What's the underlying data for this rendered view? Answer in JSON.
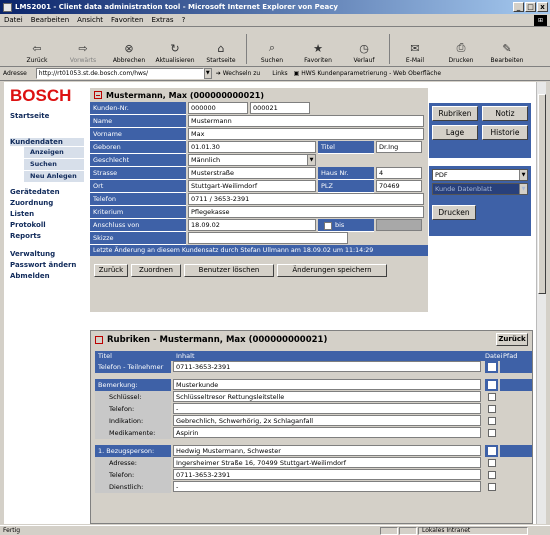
{
  "window": {
    "title": "LMS2001 - Client data administration tool - Microsoft Internet Explorer von Peacy",
    "btn_min": "_",
    "btn_max": "□",
    "btn_close": "x"
  },
  "menu": [
    "Datei",
    "Bearbeiten",
    "Ansicht",
    "Favoriten",
    "Extras",
    "?"
  ],
  "toolbar": [
    {
      "label": "Zurück",
      "icon": "back-arrow-icon",
      "glyph": "⇦"
    },
    {
      "label": "Vorwärts",
      "icon": "forward-arrow-icon",
      "glyph": "⇨"
    },
    {
      "label": "Abbrechen",
      "icon": "stop-icon",
      "glyph": "⊗"
    },
    {
      "label": "Aktualisieren",
      "icon": "refresh-icon",
      "glyph": "↻"
    },
    {
      "label": "Startseite",
      "icon": "home-icon",
      "glyph": "⌂"
    },
    {
      "label": "Suchen",
      "icon": "search-icon",
      "glyph": "⌕"
    },
    {
      "label": "Favoriten",
      "icon": "favorites-icon",
      "glyph": "★"
    },
    {
      "label": "Verlauf",
      "icon": "history-icon",
      "glyph": "◷"
    },
    {
      "label": "E-Mail",
      "icon": "mail-icon",
      "glyph": "✉"
    },
    {
      "label": "Drucken",
      "icon": "print-icon",
      "glyph": "⎙"
    },
    {
      "label": "Bearbeiten",
      "icon": "edit-icon",
      "glyph": "✎"
    }
  ],
  "address": {
    "label": "Adresse",
    "url": "http://rt01053.st.de.bosch.com/hws/",
    "go": "Wechseln zu",
    "links": "Links",
    "link_page": "HWS Kundenparametrierung - Web Oberfläche"
  },
  "nav": {
    "logo": "BOSCH",
    "startseite": "Startseite",
    "kundendaten": "Kundendaten",
    "anzeigen": "Anzeigen",
    "suchen": "Suchen",
    "neu_anlegen": "Neu Anlegen",
    "geraetedaten": "Gerätedaten",
    "zuordnung": "Zuordnung",
    "listen": "Listen",
    "protokoll": "Protokoll",
    "reports": "Reports",
    "verwaltung": "Verwaltung",
    "passwort": "Passwort ändern",
    "abmelden": "Abmelden"
  },
  "customer": {
    "header": "Mustermann, Max (000000000021)",
    "kunden_nr_label": "Kunden-Nr.",
    "kunden_nr_1": "000000",
    "kunden_nr_2": "000021",
    "name_label": "Name",
    "name": "Mustermann",
    "vorname_label": "Vorname",
    "vorname": "Max",
    "geboren_label": "Geboren",
    "geboren": "01.01.30",
    "titel_label": "Titel",
    "titel": "Dr.Ing",
    "geschlecht_label": "Geschlecht",
    "geschlecht": "Männlich",
    "strasse_label": "Strasse",
    "strasse": "Musterstraße",
    "hausnr_label": "Haus Nr.",
    "hausnr": "4",
    "ort_label": "Ort",
    "ort": "Stuttgart-Weilimdorf",
    "plz_label": "PLZ",
    "plz": "70469",
    "telefon_label": "Telefon",
    "telefon": "0711 / 3653-2391",
    "kriterium_label": "Kriterium",
    "kriterium": "Pflegekasse",
    "anschluss_label": "Anschluss von",
    "anschluss": "18.09.02",
    "bis_label": "bis",
    "skizze_label": "Skizze",
    "last_change": "Letzte Änderung an diesem Kundensatz durch Stefan Ullmann am 18.09.02 um 11:14:29"
  },
  "buttons": {
    "zurueck": "Zurück",
    "zuordnen": "Zuordnen",
    "benutzer_loeschen": "Benutzer löschen",
    "speichern": "Änderungen speichern"
  },
  "right_panel": {
    "rubriken": "Rubriken",
    "notiz": "Notiz",
    "lage": "Lage",
    "historie": "Historie",
    "format": "PDF",
    "template": "Kunde Datenblatt",
    "drucken": "Drucken"
  },
  "rubriken": {
    "header": "Rubriken - Mustermann, Max (000000000021)",
    "zurueck": "Zurück",
    "col_titel": "Titel",
    "col_inhalt": "Inhalt",
    "col_datei": "Datei",
    "col_pfad": "Pfad",
    "rows": [
      {
        "label": "Telefon - Teilnehmer",
        "value": "0711-3653-2391",
        "kind": "hd",
        "checked": true
      },
      {
        "gap": true
      },
      {
        "label": "Bemerkung:",
        "value": "Musterkunde",
        "kind": "hd",
        "checked": true
      },
      {
        "label": "Schlüssel:",
        "value": "Schlüsseltresor Rettungsleitstelle",
        "kind": "sub",
        "checked": false
      },
      {
        "label": "Telefon:",
        "value": "-",
        "kind": "sub",
        "checked": false
      },
      {
        "label": "Indikation:",
        "value": "Gebrechlich, Schwerhörig, 2x Schlaganfall",
        "kind": "sub",
        "checked": false
      },
      {
        "label": "Medikamente:",
        "value": "Aspirin",
        "kind": "sub",
        "checked": false
      },
      {
        "gap": true
      },
      {
        "label": "1. Bezugsperson:",
        "value": "Hedwig Mustermann, Schwester",
        "kind": "hd",
        "checked": true
      },
      {
        "label": "Adresse:",
        "value": "Ingersheimer Straße 16, 70499 Stuttgart-Weilimdorf",
        "kind": "sub",
        "checked": false
      },
      {
        "label": "Telefon:",
        "value": "0711-3653-2391",
        "kind": "sub",
        "checked": false
      },
      {
        "label": "Dienstlich:",
        "value": "-",
        "kind": "sub",
        "checked": false
      }
    ]
  },
  "status": {
    "left": "Fertig",
    "zone": "Lokales Intranet"
  }
}
